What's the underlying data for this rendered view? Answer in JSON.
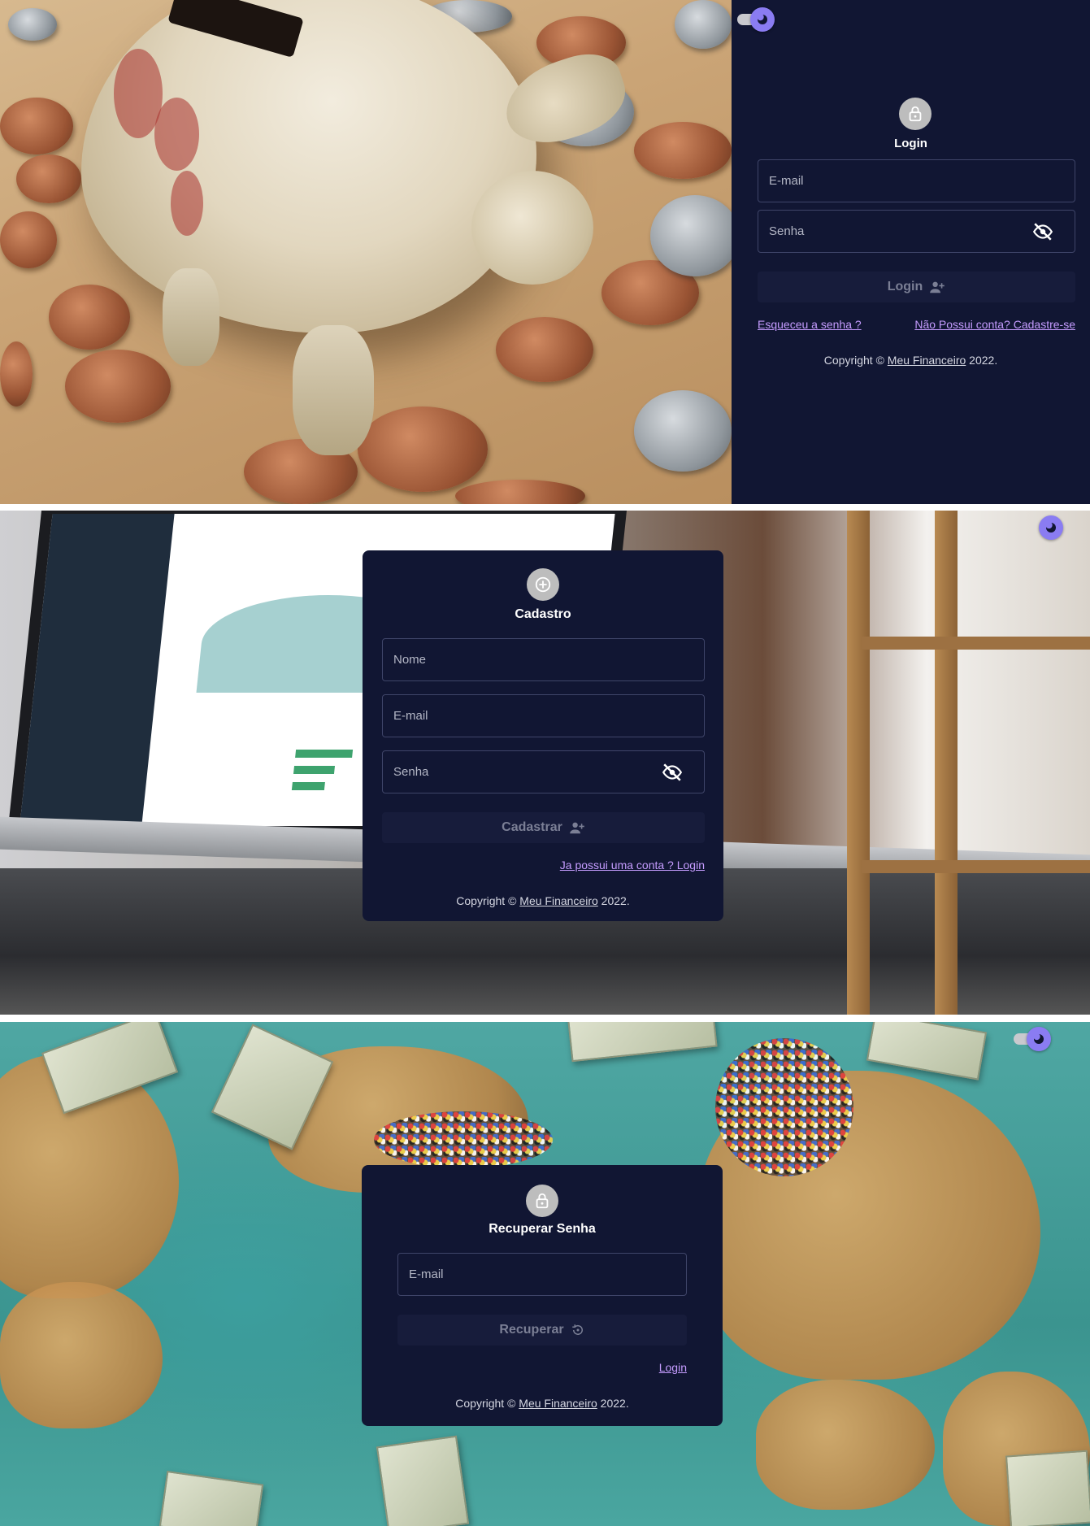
{
  "login": {
    "theme_toggle_icon": "moon-icon",
    "avatar_icon": "lock-icon",
    "title": "Login",
    "email_placeholder": "E-mail",
    "password_placeholder": "Senha",
    "password_toggle_icon": "eye-off-icon",
    "submit_label": "Login",
    "submit_icon": "person-add-icon",
    "forgot_link": "Esqueceu a senha ?",
    "register_link": "Não Possui conta? Cadastre-se",
    "copyright_prefix": "Copyright ©",
    "copyright_brand": "Meu Financeiro",
    "copyright_suffix": "2022."
  },
  "cadastro": {
    "theme_toggle_icon": "moon-icon",
    "avatar_icon": "add-circle-icon",
    "title": "Cadastro",
    "name_placeholder": "Nome",
    "email_placeholder": "E-mail",
    "password_placeholder": "Senha",
    "password_toggle_icon": "eye-off-icon",
    "submit_label": "Cadastrar",
    "submit_icon": "person-add-icon",
    "login_link": "Ja possui uma conta ? Login",
    "copyright_prefix": "Copyright ©",
    "copyright_brand": "Meu Financeiro",
    "copyright_suffix": "2022."
  },
  "recuperar": {
    "theme_toggle_icon": "moon-icon",
    "avatar_icon": "lock-icon",
    "title": "Recuperar Senha",
    "email_placeholder": "E-mail",
    "submit_label": "Recuperar",
    "submit_icon": "restore-icon",
    "login_link": "Login",
    "copyright_prefix": "Copyright ©",
    "copyright_brand": "Meu Financeiro",
    "copyright_suffix": "2022."
  },
  "colors": {
    "panel_bg": "#111633",
    "field_border": "#3f4569",
    "button_bg": "#171c3b",
    "link": "#c59cff",
    "toggle_knob": "#8a7cf2"
  }
}
